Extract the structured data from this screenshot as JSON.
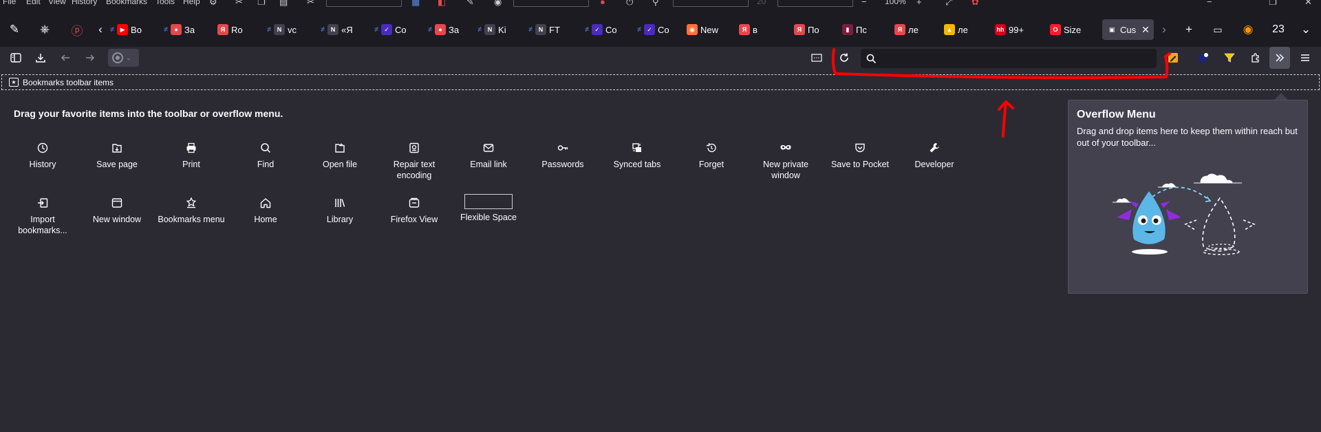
{
  "menubar": {
    "items": [
      "File",
      "Edit",
      "View",
      "History",
      "Bookmarks",
      "Tools",
      "Help"
    ],
    "zoom_value": "20",
    "zoom_percent": "100%"
  },
  "tabs": [
    {
      "label": "Во",
      "favicon": "youtube-icon",
      "color": "#ff0000",
      "glyph": "▶"
    },
    {
      "label": "За",
      "favicon": "record-icon",
      "color": "#e5484d",
      "glyph": "●"
    },
    {
      "label": "Ro",
      "favicon": "yandex-icon",
      "color": "#e5484d",
      "glyph": "Я"
    },
    {
      "label": "vc",
      "favicon": "news-icon",
      "color": "#42414d",
      "glyph": "N"
    },
    {
      "label": "«Я",
      "favicon": "news-icon",
      "color": "#42414d",
      "glyph": "N"
    },
    {
      "label": "Co",
      "favicon": "bird-icon",
      "color": "#4b2bbd",
      "glyph": "✓"
    },
    {
      "label": "За",
      "favicon": "record-icon",
      "color": "#e5484d",
      "glyph": "●"
    },
    {
      "label": "Ki",
      "favicon": "news-icon",
      "color": "#42414d",
      "glyph": "N"
    },
    {
      "label": "FT",
      "favicon": "news-icon",
      "color": "#42414d",
      "glyph": "N"
    },
    {
      "label": "Co",
      "favicon": "bird-icon",
      "color": "#4b2bbd",
      "glyph": "✓"
    },
    {
      "label": "Co",
      "favicon": "bird-icon",
      "color": "#4b2bbd",
      "glyph": "✓"
    },
    {
      "label": "New T",
      "favicon": "firefox-icon",
      "color": "#ff7139",
      "glyph": "◉"
    },
    {
      "label": "в",
      "favicon": "yandex-icon",
      "color": "#e5484d",
      "glyph": "Я"
    },
    {
      "label": "По",
      "favicon": "yandex-icon",
      "color": "#e5484d",
      "glyph": "Я"
    },
    {
      "label": "Пс",
      "favicon": "stream-icon",
      "color": "#7a1f3d",
      "glyph": "▮"
    },
    {
      "label": "ле",
      "favicon": "yandex-icon",
      "color": "#e5484d",
      "glyph": "Я"
    },
    {
      "label": "ле",
      "favicon": "image-icon",
      "color": "#f5b700",
      "glyph": "▲"
    },
    {
      "label": "99+",
      "favicon": "hh-icon",
      "color": "#d6001c",
      "glyph": "hh"
    },
    {
      "label": "Size of",
      "favicon": "opera-icon",
      "color": "#ff1b2d",
      "glyph": "O"
    },
    {
      "label": "Cus",
      "favicon": "customize-icon",
      "color": "#42414d",
      "glyph": "▣",
      "active": true
    }
  ],
  "tabstrip": {
    "tab_count": "23"
  },
  "search": {
    "placeholder": ""
  },
  "bookmarks_toolbar": {
    "label": "Bookmarks toolbar items"
  },
  "palette": {
    "heading": "Drag your favorite items into the toolbar or overflow menu.",
    "row1": [
      {
        "label": "History",
        "icon": "clock-icon"
      },
      {
        "label": "Save page",
        "icon": "save-page-icon"
      },
      {
        "label": "Print",
        "icon": "printer-icon"
      },
      {
        "label": "Find",
        "icon": "search-icon"
      },
      {
        "label": "Open file",
        "icon": "folder-icon"
      },
      {
        "label": "Repair text encoding",
        "icon": "text-encoding-icon"
      },
      {
        "label": "Email link",
        "icon": "mail-icon"
      },
      {
        "label": "Passwords",
        "icon": "key-icon"
      },
      {
        "label": "Synced tabs",
        "icon": "synced-tabs-icon"
      },
      {
        "label": "Forget",
        "icon": "forget-icon"
      },
      {
        "label": "New private window",
        "icon": "private-mask-icon"
      },
      {
        "label": "Save to Pocket",
        "icon": "pocket-icon"
      },
      {
        "label": "Developer",
        "icon": "wrench-icon"
      }
    ],
    "row2": [
      {
        "label": "Import bookmarks...",
        "icon": "import-icon"
      },
      {
        "label": "New window",
        "icon": "window-icon"
      },
      {
        "label": "Bookmarks menu",
        "icon": "bookmark-star-icon"
      },
      {
        "label": "Home",
        "icon": "home-icon"
      },
      {
        "label": "Library",
        "icon": "library-icon"
      },
      {
        "label": "Firefox View",
        "icon": "firefox-view-icon"
      },
      {
        "label": "Flexible Space",
        "icon": "flexible-space-box"
      }
    ]
  },
  "overflow_menu": {
    "title": "Overflow Menu",
    "description": "Drag and drop items here to keep them within reach but out of your toolbar..."
  },
  "colors": {
    "background": "#2b2a33",
    "tabstrip": "#1c1b22",
    "panel": "#42414d",
    "annotation": "#ff0000"
  }
}
